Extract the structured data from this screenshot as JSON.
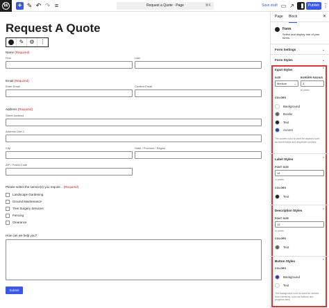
{
  "topbar": {
    "doc_title": "Request a Quote · Page",
    "shortcut": "⌘K",
    "save_draft": "Save draft",
    "publish": "Publish"
  },
  "canvas": {
    "heading": "Request A Quote",
    "name": {
      "label": "Name",
      "required": "(Required)",
      "first": "First",
      "last": "Last"
    },
    "email": {
      "label": "Email",
      "required": "(Required)",
      "enter": "Enter Email",
      "confirm": "Confirm Email"
    },
    "address": {
      "label": "Address",
      "required": "(Required)",
      "street": "Street Address",
      "line2": "Address Line 2",
      "city": "City",
      "state": "State / Province / Region",
      "zip": "ZIP / Postal Code"
    },
    "services": {
      "label": "Please select the service(s) you require...",
      "required": "(Required)",
      "options": [
        "Landscape Gardening",
        "Ground Maintenance",
        "Tree Surgery Services",
        "Fencing",
        "Clearance"
      ]
    },
    "help": {
      "label": "How can we help you?"
    },
    "submit": "Submit"
  },
  "sidebar": {
    "tabs": {
      "page": "Page",
      "block": "Block"
    },
    "block": {
      "title": "Form",
      "description": "Select and display one of your forms."
    },
    "panels": {
      "form_settings": "Form Settings",
      "form_styles": "Form Styles"
    },
    "input_styles": {
      "title": "Input Styles",
      "size_label": "SIZE",
      "size_value": "Medium",
      "radius_label": "BORDER RADIUS",
      "radius_value": "3",
      "radius_unit": "In pixels",
      "colors_label": "COLORS",
      "colors": [
        {
          "name": "Background",
          "hex": "#ffffff"
        },
        {
          "name": "Border",
          "hex": "#5f5f5f"
        },
        {
          "name": "Text",
          "hex": "#1e1e1e"
        },
        {
          "name": "Accent",
          "hex": "#1e3fb8"
        }
      ],
      "help": "The accent color is used for aspects such as checkmarks and dropdown choices."
    },
    "label_styles": {
      "title": "Label Styles",
      "font_label": "FONT SIZE",
      "font_value": "14",
      "font_unit": "In pixels",
      "colors_label": "COLORS",
      "colors": [
        {
          "name": "Text",
          "hex": "#1e1e1e"
        }
      ]
    },
    "description_styles": {
      "title": "Description Styles",
      "font_label": "FONT SIZE",
      "font_value": "13",
      "font_unit": "In pixels",
      "colors_label": "COLORS",
      "colors": [
        {
          "name": "Text",
          "hex": "#5f5f5f"
        }
      ]
    },
    "button_styles": {
      "title": "Button Styles",
      "colors_label": "COLORS",
      "colors": [
        {
          "name": "Background",
          "hex": "#1e3fb8"
        },
        {
          "name": "Text",
          "hex": "#ffffff"
        }
      ],
      "help": "The background color is used for various form elements, such as buttons and progress bars."
    }
  },
  "accent": "#3858e9",
  "highlight_color": "#d63638"
}
